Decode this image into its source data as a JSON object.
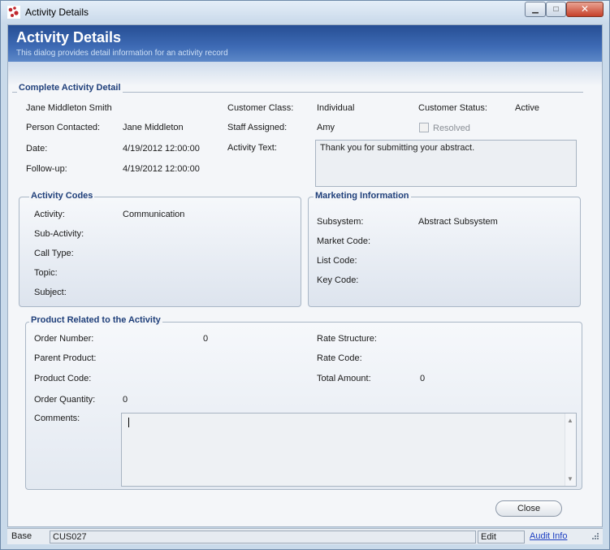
{
  "window": {
    "title": "Activity Details",
    "controls": {
      "minimize": "▁",
      "maximize": "□",
      "close": "✕"
    }
  },
  "header": {
    "title": "Activity Details",
    "subtitle": "This dialog provides detail information for an activity record"
  },
  "complete_detail": {
    "group_title": "Complete Activity Detail",
    "person_name": "Jane Middleton Smith",
    "person_contacted_label": "Person Contacted:",
    "person_contacted_value": "Jane Middleton",
    "date_label": "Date:",
    "date_value": "4/19/2012 12:00:00",
    "followup_label": "Follow-up:",
    "followup_value": "4/19/2012 12:00:00",
    "customer_class_label": "Customer Class:",
    "customer_class_value": "Individual",
    "staff_assigned_label": "Staff Assigned:",
    "staff_assigned_value": "Amy",
    "activity_text_label": "Activity Text:",
    "activity_text_value": "Thank you for submitting your abstract.",
    "customer_status_label": "Customer Status:",
    "customer_status_value": "Active",
    "resolved_label": "Resolved",
    "resolved_checked": false
  },
  "activity_codes": {
    "group_title": "Activity Codes",
    "activity_label": "Activity:",
    "activity_value": "Communication",
    "sub_activity_label": "Sub-Activity:",
    "call_type_label": "Call Type:",
    "topic_label": "Topic:",
    "subject_label": "Subject:"
  },
  "marketing": {
    "group_title": "Marketing Information",
    "subsystem_label": "Subsystem:",
    "subsystem_value": "Abstract Subsystem",
    "market_code_label": "Market Code:",
    "list_code_label": "List Code:",
    "key_code_label": "Key Code:"
  },
  "product": {
    "group_title": "Product Related to the Activity",
    "order_number_label": "Order Number:",
    "order_number_value": "0",
    "parent_product_label": "Parent Product:",
    "product_code_label": "Product Code:",
    "order_quantity_label": "Order Quantity:",
    "order_quantity_value": "0",
    "comments_label": "Comments:",
    "rate_structure_label": "Rate Structure:",
    "rate_code_label": "Rate Code:",
    "total_amount_label": "Total Amount:",
    "total_amount_value": "0"
  },
  "actions": {
    "close_label": "Close"
  },
  "statusbar": {
    "base": "Base",
    "code": "CUS027",
    "mode": "Edit",
    "audit": "Audit Info"
  }
}
